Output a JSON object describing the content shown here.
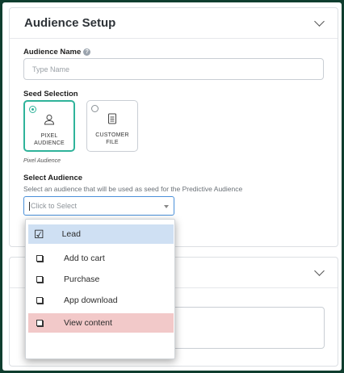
{
  "audience_setup": {
    "title": "Audience Setup",
    "name_label": "Audience Name",
    "name_placeholder": "Type Name",
    "seed_label": "Seed Selection",
    "seed_options": [
      {
        "line1": "PIXEL",
        "line2": "AUDIENCE",
        "selected": true
      },
      {
        "line1": "CUSTOMER",
        "line2": "FILE",
        "selected": false
      }
    ],
    "seed_hint": "Pixel Audience",
    "select_label": "Select Audience",
    "select_description": "Select an audience that will be used as seed for the Predictive Audience",
    "select_placeholder": "Click to Select"
  },
  "dropdown": {
    "options": [
      {
        "label": "Lead",
        "state": "checked"
      },
      {
        "label": "Add to cart",
        "state": "unchecked"
      },
      {
        "label": "Purchase",
        "state": "unchecked"
      },
      {
        "label": "App download",
        "state": "unchecked"
      },
      {
        "label": "View content",
        "state": "unchecked"
      }
    ]
  },
  "colors": {
    "accent": "#2fb39a",
    "focus_border": "#4a90d9",
    "highlight_blue": "#cfe0f3",
    "highlight_red": "#f2c9c9",
    "background": "#0f3d2e"
  },
  "icons": [
    "user-icon",
    "document-icon",
    "chevron-down-icon",
    "help-icon",
    "checkbox-icon"
  ]
}
